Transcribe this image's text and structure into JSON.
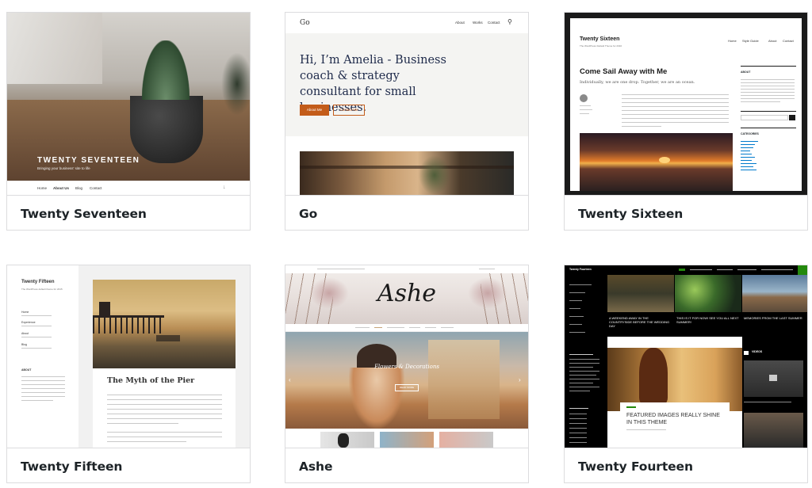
{
  "themes": [
    {
      "name": "Twenty Seventeen",
      "site_title": "TWENTY SEVENTEEN",
      "tagline": "Bringing your business' site to life",
      "nav": [
        "Home",
        "About Us",
        "Blog",
        "Contact"
      ]
    },
    {
      "name": "Go",
      "logo": "Go",
      "nav": [
        "About",
        "Works",
        "Contact"
      ],
      "headline": "Hi, I’m Amelia - Business coach & strategy consultant for small businesses.",
      "primary_button": "About Me",
      "secondary_button": "Contact Me"
    },
    {
      "name": "Twenty Sixteen",
      "site_title": "Twenty Sixteen",
      "tagline": "The WordPress Default Theme for 2016",
      "nav": [
        "Home",
        "Style Guide",
        "About",
        "Contact"
      ],
      "post_title": "Come Sail Away with Me",
      "post_excerpt": "Individually, we are one drop. Together, we are an ocean.",
      "sidebar_about": "ABOUT",
      "sidebar_categories": "CATEGORIES"
    },
    {
      "name": "Twenty Fifteen",
      "site_title": "Twenty Fifteen",
      "tagline": "The WordPress default theme for 2015",
      "menu": [
        "Home",
        "Experience",
        "About",
        "Blog"
      ],
      "sidebar_about": "ABOUT",
      "post_title": "The Myth of the Pier"
    },
    {
      "name": "Ashe",
      "logo": "Ashe",
      "slide_title": "Flowers & Decorations",
      "slide_button": "READ MORE"
    },
    {
      "name": "Twenty Fourteen",
      "site_title": "Twenty Fourteen",
      "featured_caption": "FEATURED IMAGES REALLY SHINE IN THIS THEME",
      "grid_captions": [
        "A WEEKEND AWAY IN THE COUNTRYSIDE BEFORE THE WEDDING DAY",
        "THIS IS IT FOR NOW! SEE YOU ALL NEXT SUMMER!",
        "MEMORIES FROM THE LAST SUMMER"
      ],
      "widget_title": "VIDEOS"
    }
  ],
  "colors": {
    "go_button": "#c35c1a",
    "fourteen_accent": "#24890d",
    "sixteen_frame": "#1a1a1a"
  }
}
